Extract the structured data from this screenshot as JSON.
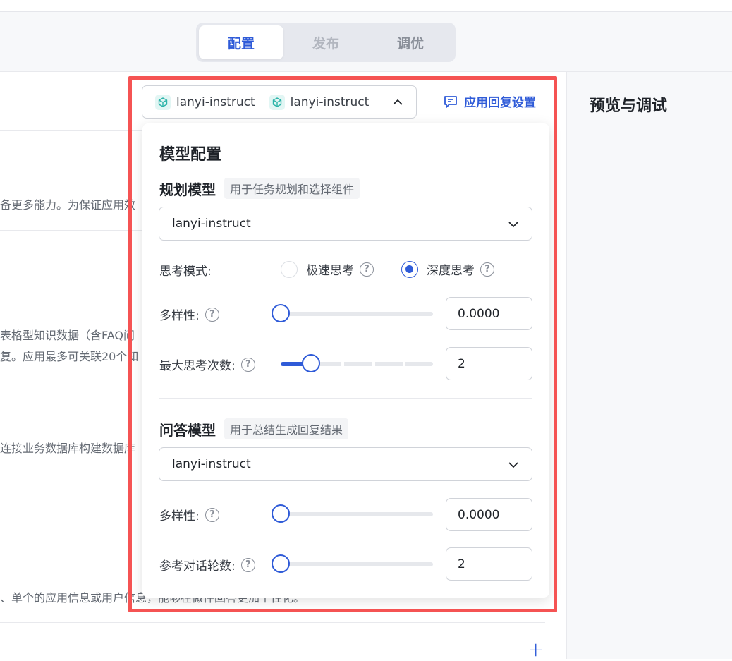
{
  "tabs": [
    {
      "label": "配置",
      "state": "active"
    },
    {
      "label": "发布",
      "state": "disabled"
    },
    {
      "label": "调优",
      "state": "normal"
    }
  ],
  "left_truncated_text": [
    "备更多能力。为保证应用效",
    "表格型知识数据（含FAQ问",
    "复。应用最多可关联20个知",
    "连接业务数据库构建数据库",
    "、单个的应用信息或用户信息，能够在微件回答更加个性化。"
  ],
  "model_bar": {
    "models": [
      "lanyi-instruct",
      "lanyi-instruct"
    ]
  },
  "reply_settings": {
    "label": "应用回复设置",
    "icon": "message-icon"
  },
  "preview_title": "预览与调试",
  "panel": {
    "title": "模型配置",
    "planning": {
      "title": "规划模型",
      "tag": "用于任务规划和选择组件",
      "selected_model": "lanyi-instruct",
      "thinking_mode": {
        "label": "思考模式:",
        "options": [
          "极速思考",
          "深度思考"
        ],
        "selected": "深度思考"
      },
      "diversity": {
        "label": "多样性:",
        "value": "0.0000",
        "slider_fraction": 0.0
      },
      "max_thinking": {
        "label": "最大思考次数:",
        "value": "2",
        "slider_fraction": 0.2
      }
    },
    "qa": {
      "title": "问答模型",
      "tag": "用于总结生成回复结果",
      "selected_model": "lanyi-instruct",
      "diversity": {
        "label": "多样性:",
        "value": "0.0000",
        "slider_fraction": 0.0
      },
      "history_rounds": {
        "label": "参考对话轮数:",
        "value": "2",
        "slider_fraction": 0.0
      }
    }
  },
  "colors": {
    "accent": "#2f5bd8",
    "highlight_frame": "#f55353"
  }
}
